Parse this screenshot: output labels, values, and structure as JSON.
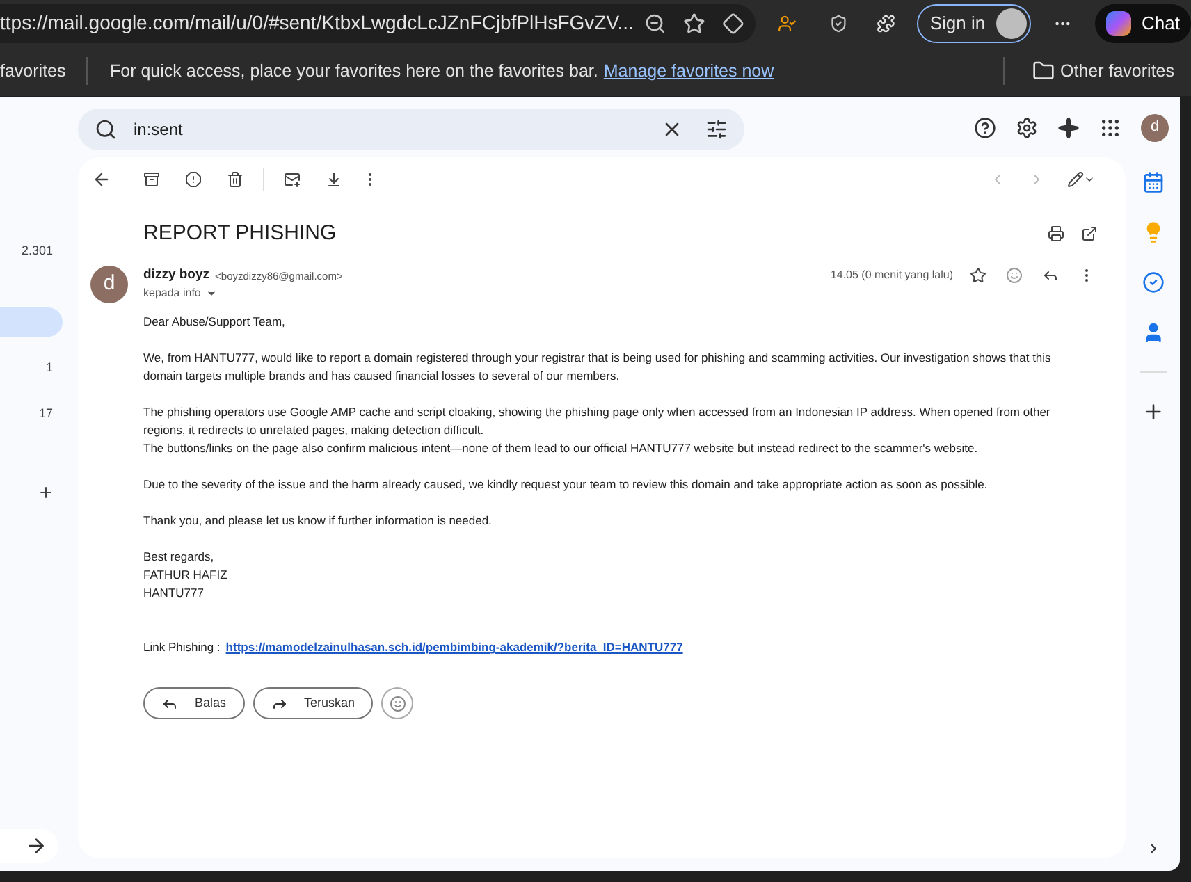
{
  "browser": {
    "url": "ttps://mail.google.com/mail/u/0/#sent/KtbxLwgdcLcJZnFCjbfPlHsFGvZV...",
    "sign_in": "Sign in",
    "chat": "Chat",
    "favorites_left": "favorites",
    "favorites_message": "For quick access, place your favorites here on the favorites bar.",
    "favorites_link": "Manage favorites now",
    "other_favorites": "Other favorites"
  },
  "search": {
    "value": "in:sent"
  },
  "account": {
    "initial": "d"
  },
  "sidebar": {
    "items": [
      {
        "count": "2.301",
        "selected": false
      },
      {
        "selected": true
      },
      {
        "count": "1",
        "selected": false
      },
      {
        "count": "17",
        "selected": false
      }
    ]
  },
  "email": {
    "subject": "REPORT PHISHING",
    "sender_initial": "d",
    "sender_name": "dizzy boyz",
    "sender_email": "<boyzdizzy86@gmail.com>",
    "recipient": "kepada info",
    "time": "14.05 (0 menit yang lalu)",
    "body": [
      "Dear Abuse/Support Team,",
      "We, from HANTU777, would like to report a domain registered through your registrar that is being used for phishing and scamming activities. Our investigation shows that this domain targets multiple brands and has caused financial losses to several of our members.",
      "The phishing operators use Google AMP cache and script cloaking, showing the phishing page only when accessed from an Indonesian IP address. When opened from other regions, it redirects to unrelated pages, making detection difficult.\nThe buttons/links on the page also confirm malicious intent—none of them lead to our official HANTU777 website but instead redirect to the scammer's website.",
      "Due to the severity of the issue and the harm already caused, we kindly request your team to review this domain and take appropriate action as soon as possible.",
      "Thank you, and please let us know if further information is needed.",
      "Best regards,\nFATHUR HAFIZ\nHANTU777"
    ],
    "link_label": "Link Phishing :",
    "link": "https://mamodelzainulhasan.sch.id/pembimbing-akademik/?berita_ID=HANTU777",
    "actions": [
      "Balas",
      "Teruskan"
    ]
  }
}
